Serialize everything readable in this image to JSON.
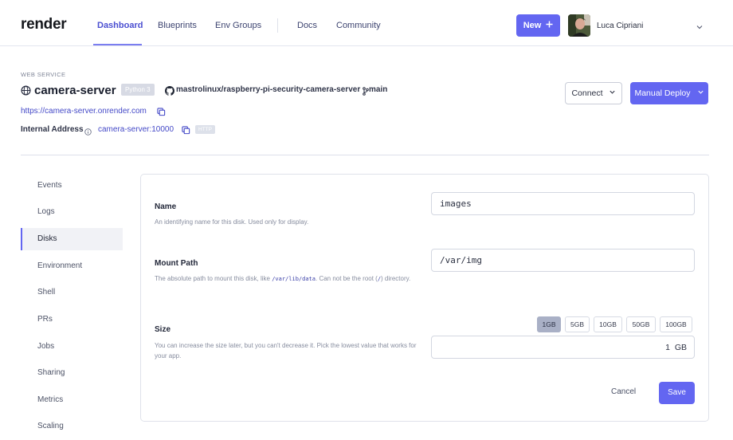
{
  "nav": {
    "logo": "render",
    "links": [
      {
        "label": "Dashboard"
      },
      {
        "label": "Blueprints"
      },
      {
        "label": "Env Groups"
      },
      {
        "label": "Docs"
      },
      {
        "label": "Community"
      }
    ],
    "new_label": "New",
    "user_name": "Luca Cipriani"
  },
  "service": {
    "type_label": "WEB SERVICE",
    "name": "camera-server",
    "runtime": "Python 3",
    "repo": "mastrolinux/raspberry-pi-security-camera-server",
    "branch": "main",
    "url": "https://camera-server.onrender.com",
    "internal_address_label": "Internal Address",
    "internal_address": "camera-server:10000",
    "protocol_badge": "HTTP"
  },
  "actions": {
    "connect_label": "Connect",
    "deploy_label": "Manual Deploy"
  },
  "sidebar": {
    "items": [
      {
        "label": "Events"
      },
      {
        "label": "Logs"
      },
      {
        "label": "Disks"
      },
      {
        "label": "Environment"
      },
      {
        "label": "Shell"
      },
      {
        "label": "PRs"
      },
      {
        "label": "Jobs"
      },
      {
        "label": "Sharing"
      },
      {
        "label": "Metrics"
      },
      {
        "label": "Scaling"
      }
    ],
    "active": "Disks"
  },
  "disk_form": {
    "name": {
      "label": "Name",
      "description": "An identifying name for this disk. Used only for display.",
      "value": "images"
    },
    "mount_path": {
      "label": "Mount Path",
      "description_before": "The absolute path to mount this disk, like ",
      "description_code1": "/var/lib/data",
      "description_middle": ". Can not be the root (",
      "description_code2": "/",
      "description_after": ") directory.",
      "value": "/var/img"
    },
    "size": {
      "label": "Size",
      "description": "You can increase the size later, but you can't decrease it. Pick the lowest value that works for your app.",
      "options": [
        "1GB",
        "5GB",
        "10GB",
        "50GB",
        "100GB"
      ],
      "selected": "1GB",
      "value": "1",
      "unit": "GB"
    },
    "cancel_label": "Cancel",
    "save_label": "Save"
  },
  "colors": {
    "accent": "#6366f1",
    "link": "#4348c7"
  }
}
